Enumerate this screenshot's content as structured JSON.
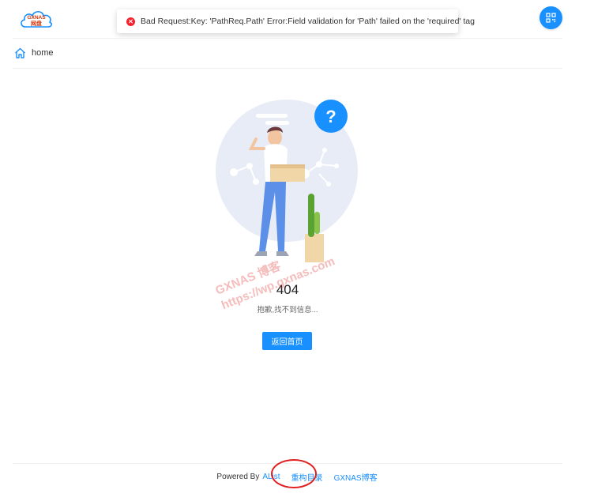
{
  "header": {
    "logo": {
      "top_text": "GXNAS",
      "bottom_text": "网盘",
      "icon": "cloud-logo"
    },
    "qr_button": {
      "icon": "qrcode-icon"
    }
  },
  "toast": {
    "icon": "error-circle-icon",
    "message": "Bad Request:Key: 'PathReq.Path' Error:Field validation for 'Path' failed on the 'required' tag"
  },
  "breadcrumb": {
    "icon": "home-icon",
    "label": "home"
  },
  "error_page": {
    "code": "404",
    "subtitle": "抱歉,找不到信息...",
    "back_button": "返回首页",
    "illustration": "confused-person-holding-box-question-mark"
  },
  "watermark": {
    "line1": "GXNAS 博客",
    "line2": "https://wp.gxnas.com"
  },
  "footer": {
    "powered_by": "Powered By",
    "alist_link": "AList",
    "rebuild_link": "重构目录",
    "blog_link": "GXNAS博客"
  },
  "colors": {
    "primary": "#1890ff",
    "error": "#f5222d",
    "annotation": "#e02020"
  }
}
